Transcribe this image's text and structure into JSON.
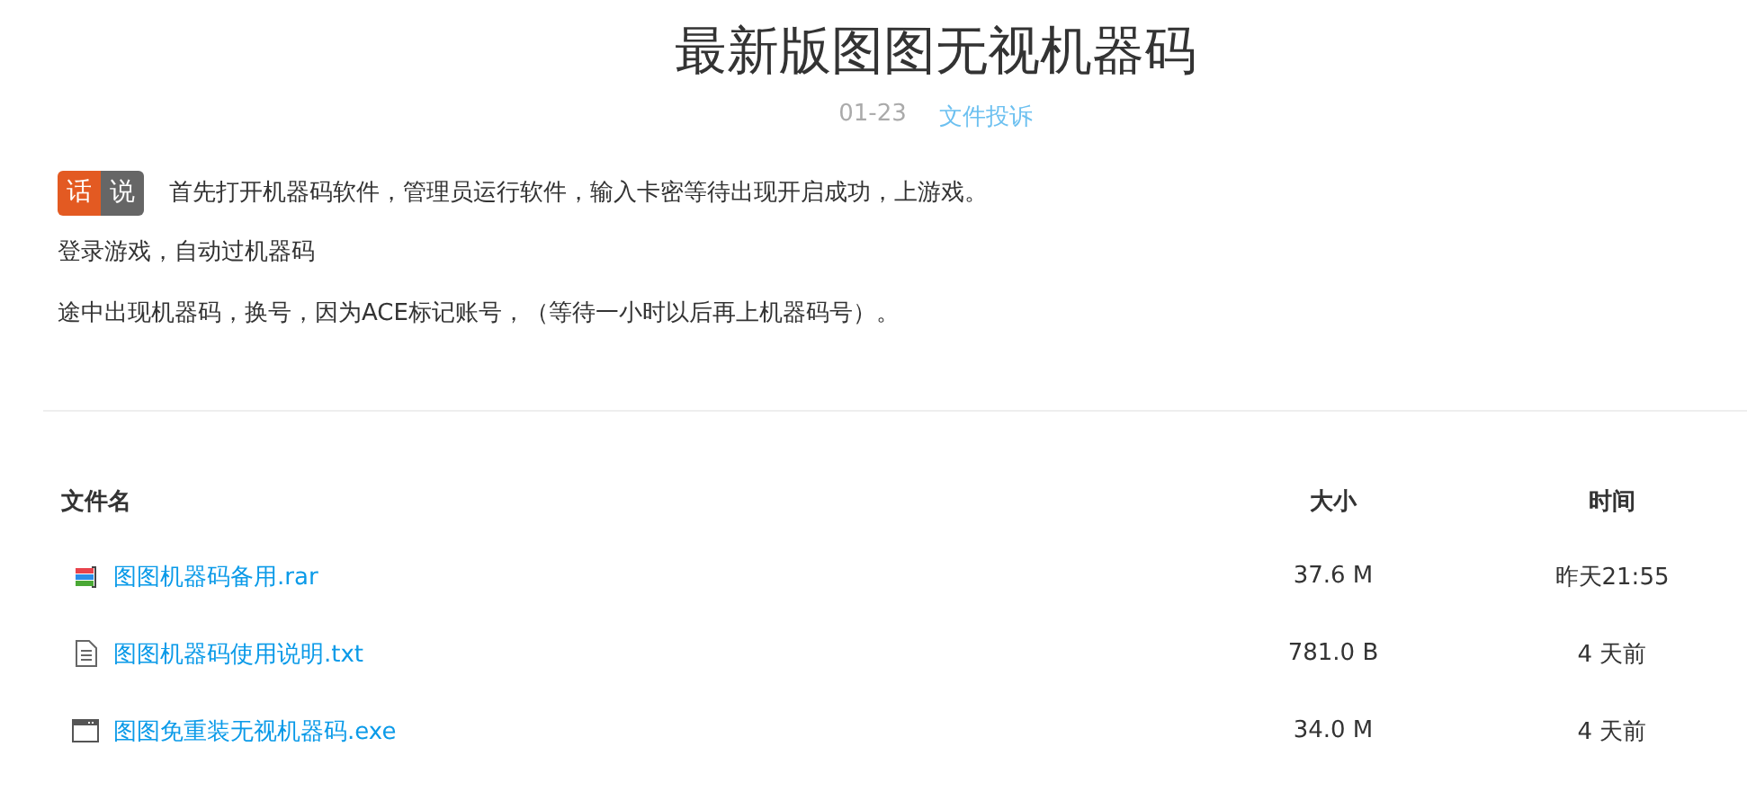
{
  "article": {
    "title": "最新版图图无视机器码",
    "date": "01-23",
    "report_link": "文件投诉",
    "badge": [
      "话",
      "说"
    ],
    "paragraphs": [
      "首先打开机器码软件，管理员运行软件，输入卡密等待出现开启成功，上游戏。",
      "登录游戏，自动过机器码",
      "途中出现机器码，换号，因为ACE标记账号，（等待一小时以后再上机器码号）。"
    ]
  },
  "files": {
    "columns": [
      "文件名",
      "大小",
      "时间"
    ],
    "rows": [
      {
        "kind": "archive",
        "name": "图图机器码备用.rar",
        "size": "37.6 M",
        "time": "昨天21:55"
      },
      {
        "kind": "text",
        "name": "图图机器码使用说明.txt",
        "size": "781.0 B",
        "time": "4 天前"
      },
      {
        "kind": "program",
        "name": "图图免重装无视机器码.exe",
        "size": "34.0 M",
        "time": "4 天前"
      }
    ]
  }
}
